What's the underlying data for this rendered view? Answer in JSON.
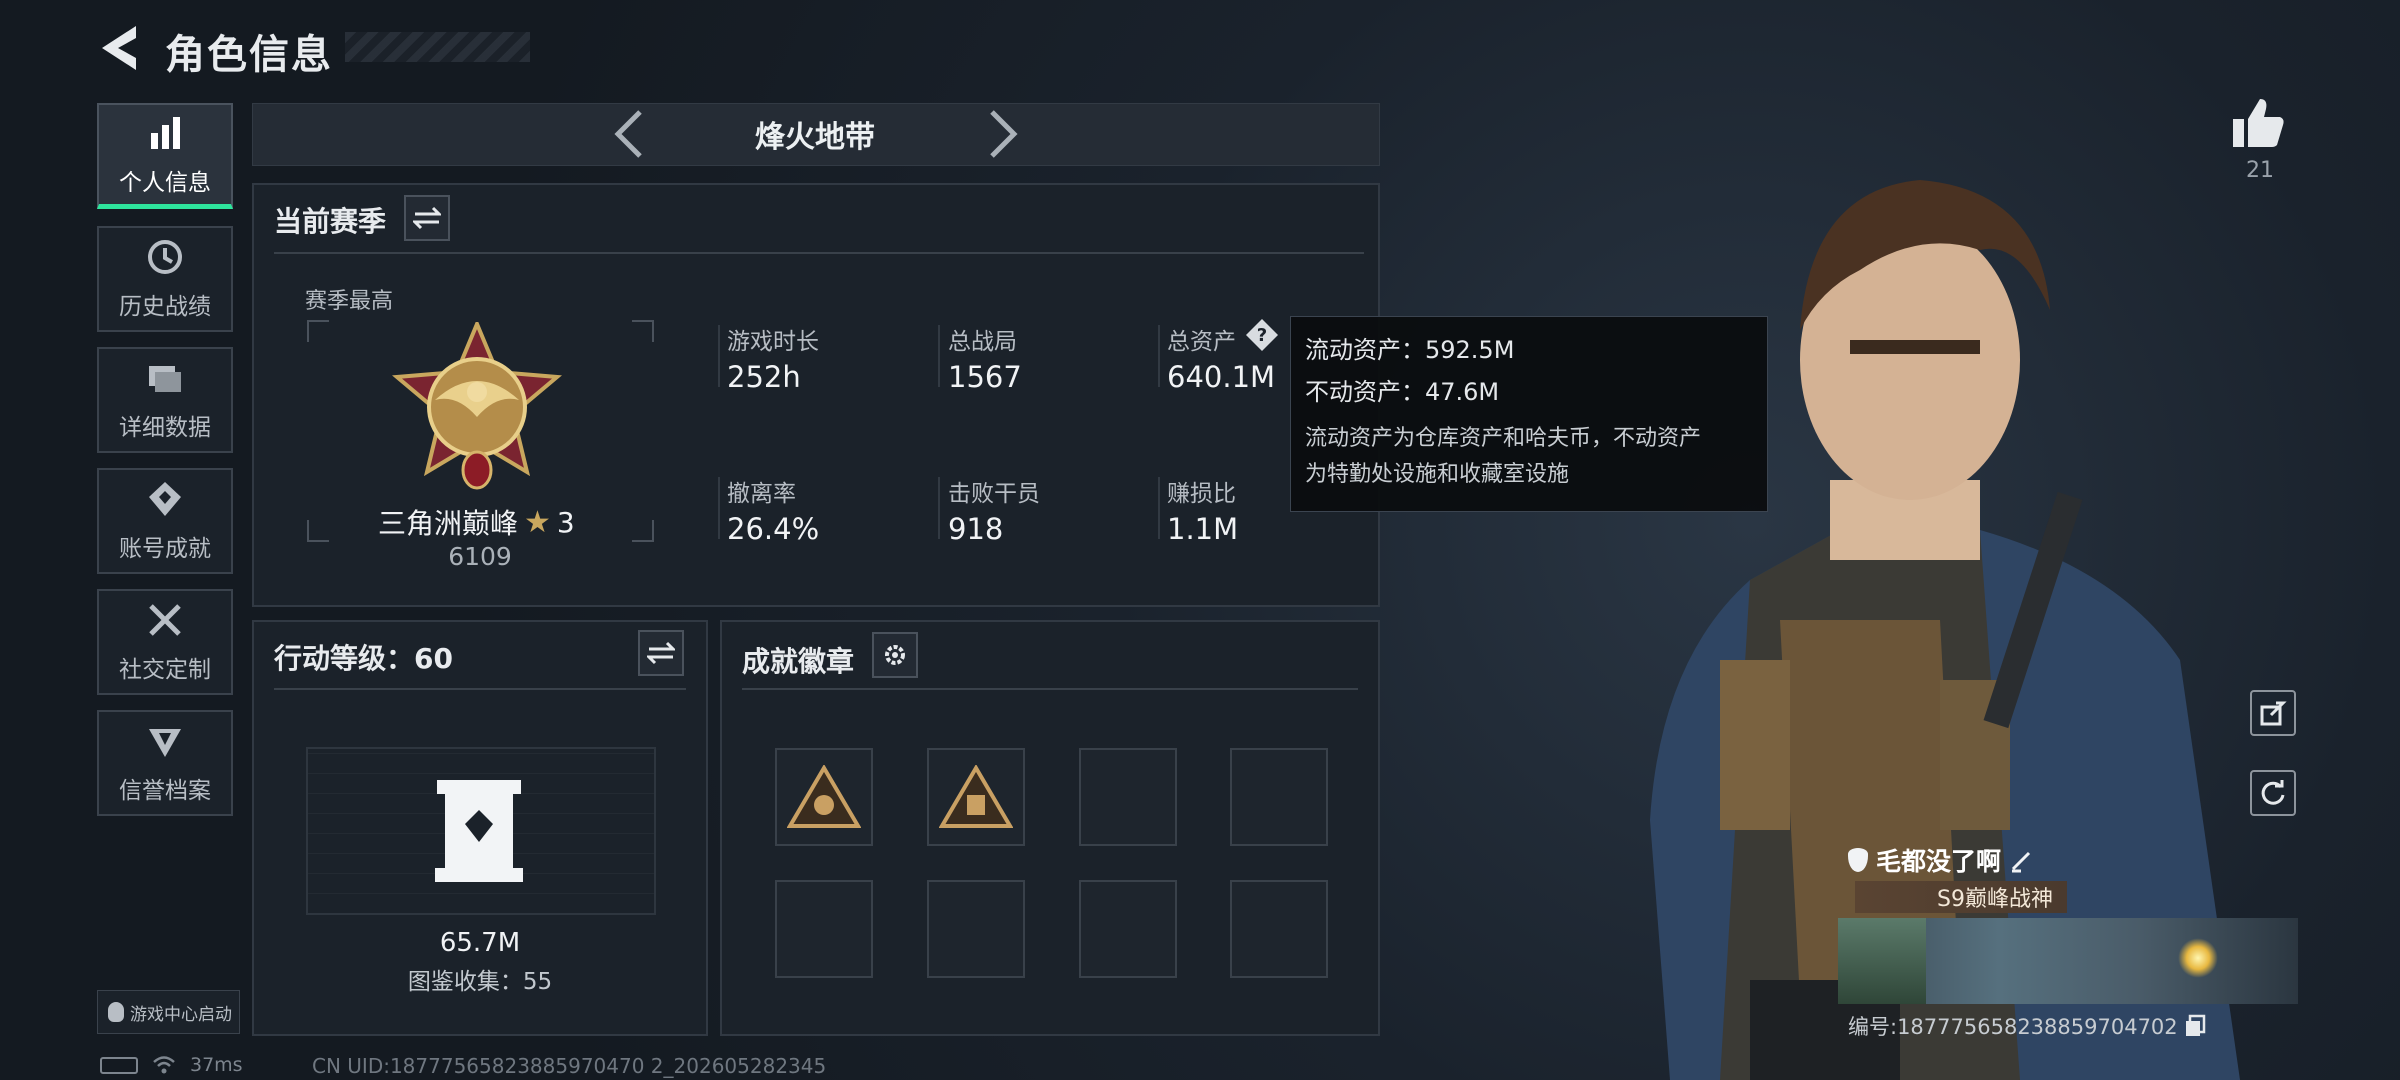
{
  "header": {
    "title": "角色信息"
  },
  "nav": {
    "items": [
      {
        "label": "个人信息",
        "icon": "bar-chart-icon",
        "active": true
      },
      {
        "label": "历史战绩",
        "icon": "history-icon"
      },
      {
        "label": "详细数据",
        "icon": "folder-icon"
      },
      {
        "label": "账号成就",
        "icon": "achievement-icon"
      },
      {
        "label": "社交定制",
        "icon": "tools-icon"
      },
      {
        "label": "信誉档案",
        "icon": "credit-icon"
      }
    ],
    "launch_label": "游戏中心启动"
  },
  "status": {
    "ping": "37ms",
    "uid": "CN UID:18777565823885970470 2_202605282345"
  },
  "mode": {
    "title": "烽火地带"
  },
  "season": {
    "title": "当前赛季",
    "best_label": "赛季最高",
    "rank_name": "三角洲巅峰",
    "rank_stars": "3",
    "rank_score": "6109",
    "stats": [
      {
        "label": "游戏时长",
        "value": "252h"
      },
      {
        "label": "总战局",
        "value": "1567"
      },
      {
        "label": "总资产",
        "value": "640.1M"
      },
      {
        "label": "撤离率",
        "value": "26.4%"
      },
      {
        "label": "击败干员",
        "value": "918"
      },
      {
        "label": "赚损比",
        "value": "1.1M"
      }
    ]
  },
  "tooltip": {
    "liquid": "流动资产：592.5M",
    "fixed": "不动资产：47.6M",
    "desc1": "流动资产为仓库资产和哈夫币，不动资产",
    "desc2": "为特勤处设施和收藏室设施"
  },
  "action_level": {
    "title": "行动等级：60",
    "value": "65.7M",
    "collection": "图鉴收集：55"
  },
  "badges": {
    "title": "成就徽章"
  },
  "profile": {
    "likes": "21",
    "name": "毛都没了啊",
    "title_plate": "S9巅峰战神",
    "serial": "编号:187775658238859704702"
  },
  "colors": {
    "accent": "#2ee59d",
    "panel": "#1b222a",
    "bg": "#161c24"
  }
}
